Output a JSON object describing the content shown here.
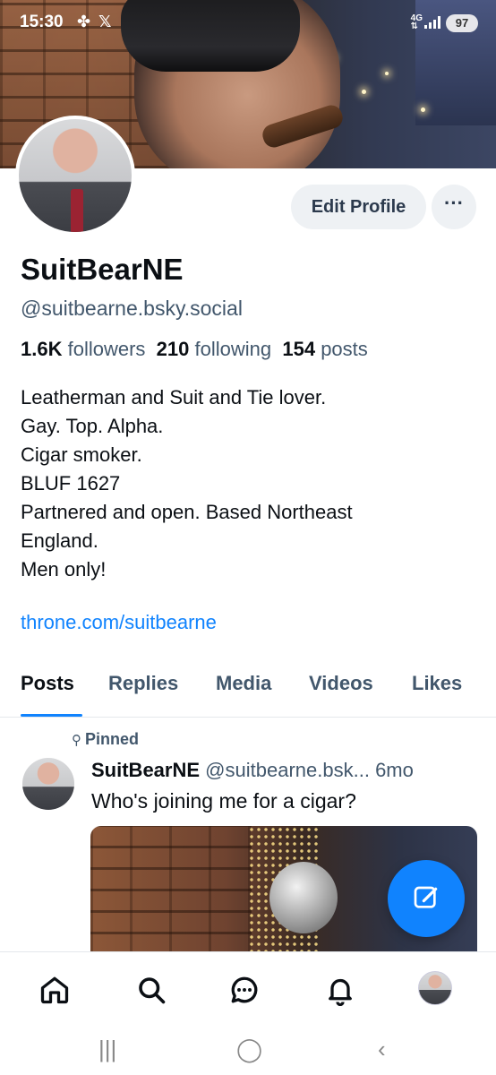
{
  "status_bar": {
    "time": "15:30",
    "network": "4G",
    "battery": "97"
  },
  "profile": {
    "display_name": "SuitBearNE",
    "handle": "@suitbearne.bsky.social",
    "followers_count": "1.6K",
    "followers_label": "followers",
    "following_count": "210",
    "following_label": "following",
    "posts_count": "154",
    "posts_label": "posts",
    "bio_lines": [
      "Leatherman and Suit and Tie lover.",
      "Gay. Top. Alpha.",
      "Cigar smoker.",
      "BLUF 1627",
      "Partnered and open. Based Northeast",
      "England.",
      "Men only!"
    ],
    "link": "throne.com/suitbearne"
  },
  "actions": {
    "edit_profile": "Edit Profile",
    "more": "···"
  },
  "tabs": [
    "Posts",
    "Replies",
    "Media",
    "Videos",
    "Likes"
  ],
  "active_tab": "Posts",
  "post": {
    "pinned_label": "Pinned",
    "author": "SuitBearNE",
    "handle": "@suitbearne.bsk...",
    "age": "6mo",
    "text": "Who's joining me for a cigar?"
  },
  "colors": {
    "accent": "#1083fe",
    "muted": "#42576c",
    "button_bg": "#eef1f4"
  },
  "bottom_nav": [
    "home-icon",
    "search-icon",
    "chat-icon",
    "bell-icon",
    "profile-avatar"
  ]
}
